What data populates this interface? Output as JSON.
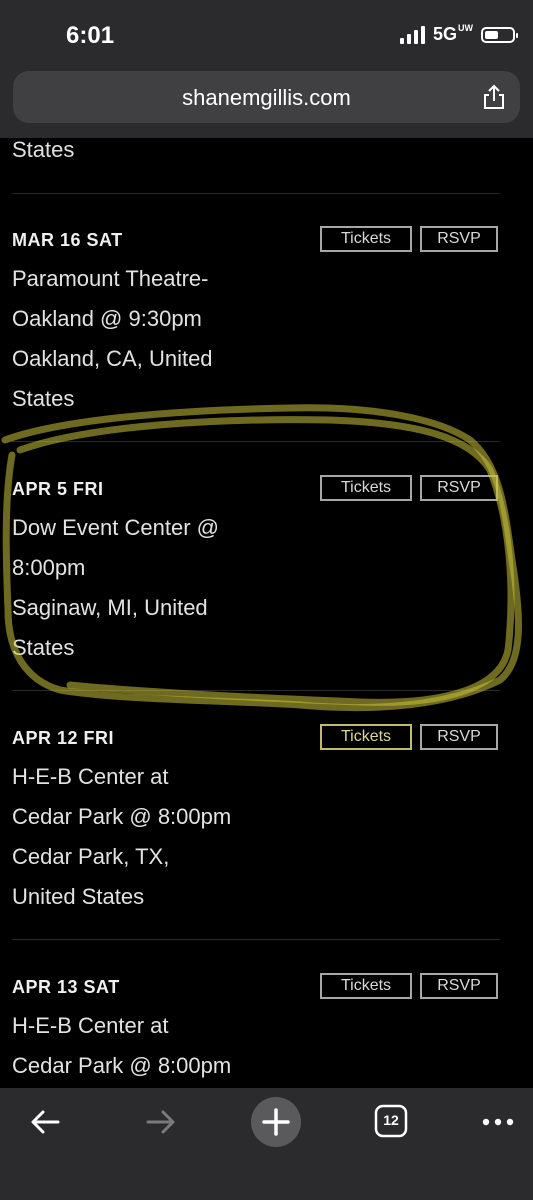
{
  "status": {
    "time": "6:01",
    "network": "5G",
    "network_sup": "UW"
  },
  "browser": {
    "url": "shanemgillis.com",
    "tab_count": "12"
  },
  "partial_previous": {
    "location_tail": "States"
  },
  "events": [
    {
      "date": "MAR 16  SAT",
      "tickets_label": "Tickets",
      "rsvp_label": "RSVP",
      "lines": [
        "Paramount Theatre-",
        "Oakland @ 9:30pm",
        "Oakland, CA, United",
        "States"
      ]
    },
    {
      "date": "APR 5  FRI",
      "tickets_label": "Tickets",
      "rsvp_label": "RSVP",
      "lines": [
        "Dow Event Center @",
        "8:00pm",
        "Saginaw, MI, United",
        "States"
      ]
    },
    {
      "date": "APR 12  FRI",
      "tickets_label": "Tickets",
      "rsvp_label": "RSVP",
      "lines": [
        "H-E-B Center at",
        "Cedar Park @ 8:00pm",
        "Cedar Park, TX,",
        "United States"
      ]
    },
    {
      "date": "APR 13  SAT",
      "tickets_label": "Tickets",
      "rsvp_label": "RSVP",
      "lines": [
        "H-E-B Center at",
        "Cedar Park @ 8:00pm"
      ]
    }
  ],
  "colors": {
    "background": "#000000",
    "chrome": "#2b2b2d",
    "highlight": "#c9c13a"
  },
  "icons": [
    "share-icon",
    "back-arrow-icon",
    "forward-arrow-icon",
    "new-tab-plus-icon",
    "tabs-count-icon",
    "more-icon"
  ]
}
